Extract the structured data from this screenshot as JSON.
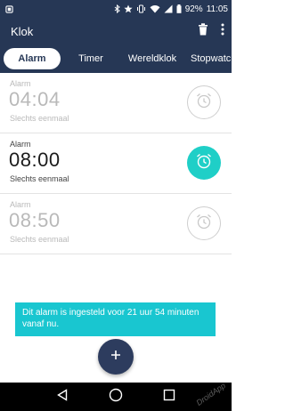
{
  "status_bar": {
    "battery": "92%",
    "time": "11:05",
    "icons": [
      "notification-icon",
      "bluetooth-icon",
      "star-icon",
      "vibrate-icon",
      "wifi-icon",
      "signal-icon",
      "battery-icon"
    ]
  },
  "app_bar": {
    "title": "Klok",
    "actions": [
      "trash-icon",
      "overflow-menu-icon"
    ]
  },
  "tabs": [
    {
      "label": "Alarm",
      "active": true
    },
    {
      "label": "Timer",
      "active": false
    },
    {
      "label": "Wereldklok",
      "active": false
    },
    {
      "label": "Stopwatch",
      "active": false
    }
  ],
  "alarms": [
    {
      "label": "Alarm",
      "time": "04:04",
      "repeat": "Slechts eenmaal",
      "enabled": false
    },
    {
      "label": "Alarm",
      "time": "08:00",
      "repeat": "Slechts eenmaal",
      "enabled": true
    },
    {
      "label": "Alarm",
      "time": "08:50",
      "repeat": "Slechts eenmaal",
      "enabled": false
    }
  ],
  "snackbar": {
    "text": "Dit alarm is ingesteld voor 21 uur 54 minuten vanaf nu."
  },
  "fab": {
    "icon": "plus-icon",
    "label": "+"
  },
  "nav_bar": {
    "buttons": [
      "back-icon",
      "home-icon",
      "recents-icon"
    ]
  },
  "watermark": "DroidApp",
  "colors": {
    "app_bar": "#263755",
    "active_toggle": "#1fcfc7",
    "snackbar": "#19c6d0",
    "fab": "#2d3c5e"
  }
}
